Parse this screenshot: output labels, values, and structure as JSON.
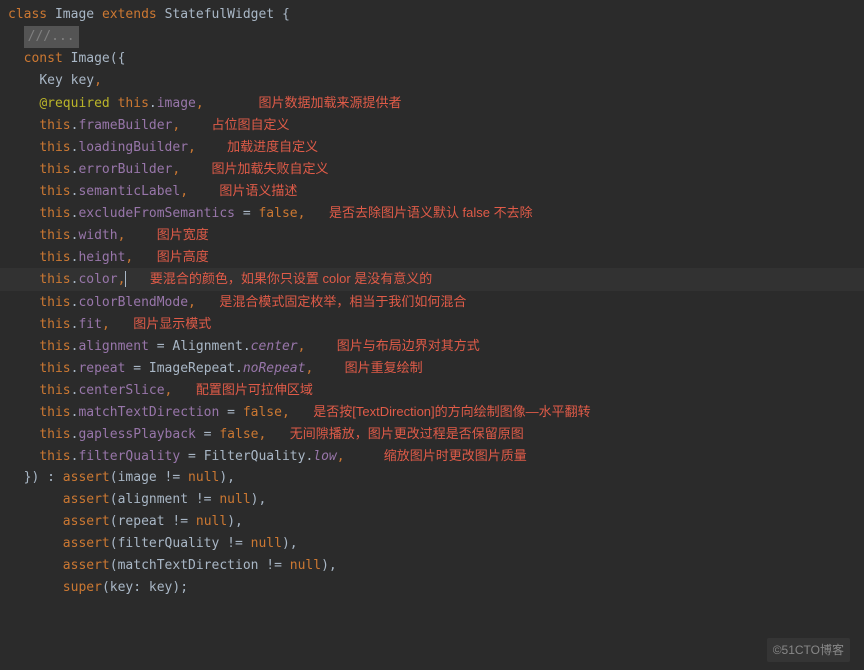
{
  "code": {
    "class_decl": {
      "kw_class": "class",
      "name": "Image",
      "kw_extends": "extends",
      "super": "StatefulWidget",
      "open": " {"
    },
    "comment": "///...",
    "const_decl": {
      "kw_const": "const",
      "ctor_name": "Image",
      "open": "({"
    },
    "params": {
      "key": {
        "type": "Key",
        "name": "key",
        "comma": ","
      },
      "image": {
        "meta": "@required",
        "this": "this",
        "field": "image",
        "comma": ","
      },
      "frameBuilder": {
        "this": "this",
        "field": "frameBuilder",
        "comma": ","
      },
      "loadingBuilder": {
        "this": "this",
        "field": "loadingBuilder",
        "comma": ","
      },
      "errorBuilder": {
        "this": "this",
        "field": "errorBuilder",
        "comma": ","
      },
      "semanticLabel": {
        "this": "this",
        "field": "semanticLabel",
        "comma": ","
      },
      "excludeFromSemantics": {
        "this": "this",
        "field": "excludeFromSemantics",
        "eq": " = ",
        "val": "false",
        "comma": ","
      },
      "width": {
        "this": "this",
        "field": "width",
        "comma": ","
      },
      "height": {
        "this": "this",
        "field": "height",
        "comma": ","
      },
      "color": {
        "this": "this",
        "field": "color",
        "comma": ","
      },
      "colorBlendMode": {
        "this": "this",
        "field": "colorBlendMode",
        "comma": ","
      },
      "fit": {
        "this": "this",
        "field": "fit",
        "comma": ","
      },
      "alignment": {
        "this": "this",
        "field": "alignment",
        "eq": " = ",
        "cls": "Alignment",
        "dot": ".",
        "val": "center",
        "comma": ","
      },
      "repeat": {
        "this": "this",
        "field": "repeat",
        "eq": " = ",
        "cls": "ImageRepeat",
        "dot": ".",
        "val": "noRepeat",
        "comma": ","
      },
      "centerSlice": {
        "this": "this",
        "field": "centerSlice",
        "comma": ","
      },
      "matchTextDirection": {
        "this": "this",
        "field": "matchTextDirection",
        "eq": " = ",
        "val": "false",
        "comma": ","
      },
      "gaplessPlayback": {
        "this": "this",
        "field": "gaplessPlayback",
        "eq": " = ",
        "val": "false",
        "comma": ","
      },
      "filterQuality": {
        "this": "this",
        "field": "filterQuality",
        "eq": " = ",
        "cls": "FilterQuality",
        "dot": ".",
        "val": "low",
        "comma": ","
      }
    },
    "close_params": "}) : ",
    "asserts": {
      "a1": {
        "kw": "assert",
        "open": "(",
        "expr": "image != ",
        "null": "null",
        "close": "),"
      },
      "a2": {
        "kw": "assert",
        "open": "(",
        "expr": "alignment != ",
        "null": "null",
        "close": "),"
      },
      "a3": {
        "kw": "assert",
        "open": "(",
        "expr": "repeat != ",
        "null": "null",
        "close": "),"
      },
      "a4": {
        "kw": "assert",
        "open": "(",
        "expr": "filterQuality != ",
        "null": "null",
        "close": "),"
      },
      "a5": {
        "kw": "assert",
        "open": "(",
        "expr": "matchTextDirection != ",
        "null": "null",
        "close": "),"
      },
      "super": {
        "kw": "super",
        "open": "(",
        "param": "key: key",
        "close": ");"
      }
    }
  },
  "notes": {
    "image": "图片数据加载来源提供者",
    "frameBuilder": "占位图自定义",
    "loadingBuilder": "加载进度自定义",
    "errorBuilder": "图片加载失败自定义",
    "semanticLabel": "图片语义描述",
    "excludeFromSemantics": "是否去除图片语义默认 false 不去除",
    "width": "图片宽度",
    "height": "图片高度",
    "color": "要混合的颜色，如果你只设置 color 是没有意义的",
    "colorBlendMode": "是混合模式固定枚举，相当于我们如何混合",
    "fit": "图片显示模式",
    "alignment": "图片与布局边界对其方式",
    "repeat": "图片重复绘制",
    "centerSlice": "配置图片可拉伸区域",
    "matchTextDirection": "是否按[TextDirection]的方向绘制图像—水平翻转",
    "gaplessPlayback": "无间隙播放，图片更改过程是否保留原图",
    "filterQuality": "缩放图片时更改图片质量"
  },
  "watermark": "©51CTO博客"
}
